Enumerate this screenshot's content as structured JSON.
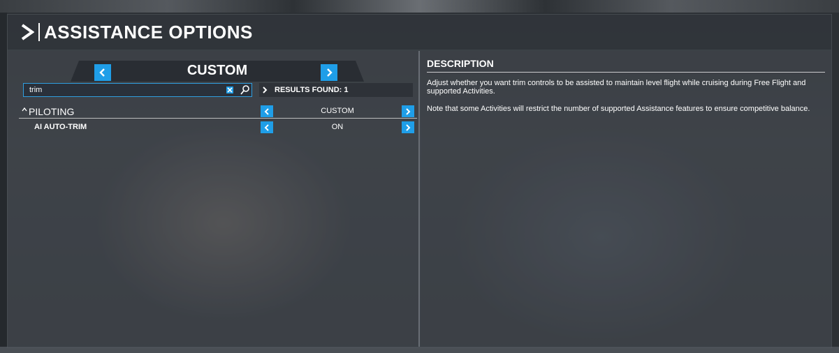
{
  "title": "ASSISTANCE OPTIONS",
  "colors": {
    "accent": "#1f9ee8",
    "panel": "#464b52",
    "text": "#ffffff"
  },
  "preset": {
    "label": "CUSTOM",
    "prev_icon": "chevron-left-icon",
    "next_icon": "chevron-right-icon"
  },
  "search": {
    "value": "trim",
    "clear_icon": "close-icon",
    "search_icon": "search-icon"
  },
  "results": {
    "text": "RESULTS FOUND: 1"
  },
  "sections": [
    {
      "caret": "^",
      "label": "PILOTING",
      "value": "CUSTOM"
    }
  ],
  "options": [
    {
      "label": "AI AUTO-TRIM",
      "value": "ON"
    }
  ],
  "description": {
    "title": "DESCRIPTION",
    "paragraph1": "Adjust whether you want trim controls to be assisted to maintain level flight while cruising during Free Flight and supported Activities.",
    "paragraph2": "Note that some Activities will restrict the number of supported Assistance features to ensure competitive balance."
  }
}
